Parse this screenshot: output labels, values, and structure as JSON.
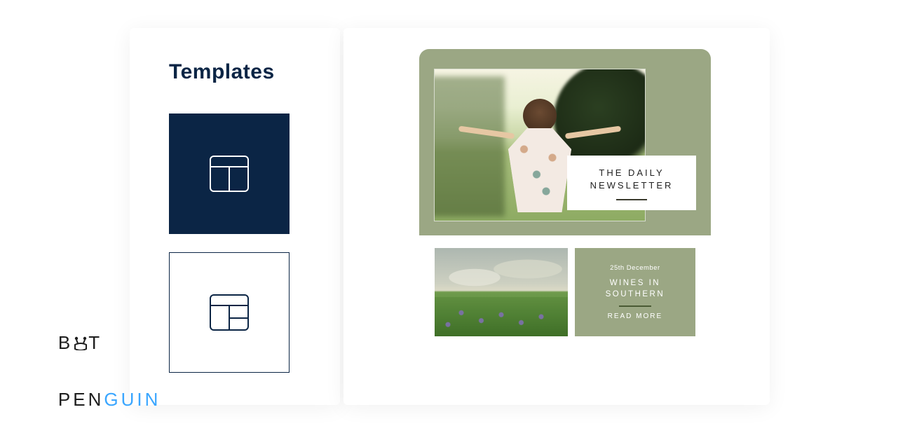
{
  "sidebar": {
    "title": "Templates",
    "options": [
      {
        "id": "layout-a",
        "selected": true
      },
      {
        "id": "layout-b",
        "selected": false
      }
    ]
  },
  "preview": {
    "hero": {
      "title_line1": "THE DAILY",
      "title_line2": "NEWSLETTER"
    },
    "article": {
      "date": "25th December",
      "headline_line1": "WINES IN",
      "headline_line2": "SOUTHERN",
      "read_more": "READ MORE"
    }
  },
  "branding": {
    "line1_a": "B",
    "line1_b": "T",
    "line2_a": "PEN",
    "line2_b": "GUIN"
  },
  "colors": {
    "navy": "#0b2545",
    "sage": "#9ba784",
    "brand_blue": "#3aa6ff"
  }
}
